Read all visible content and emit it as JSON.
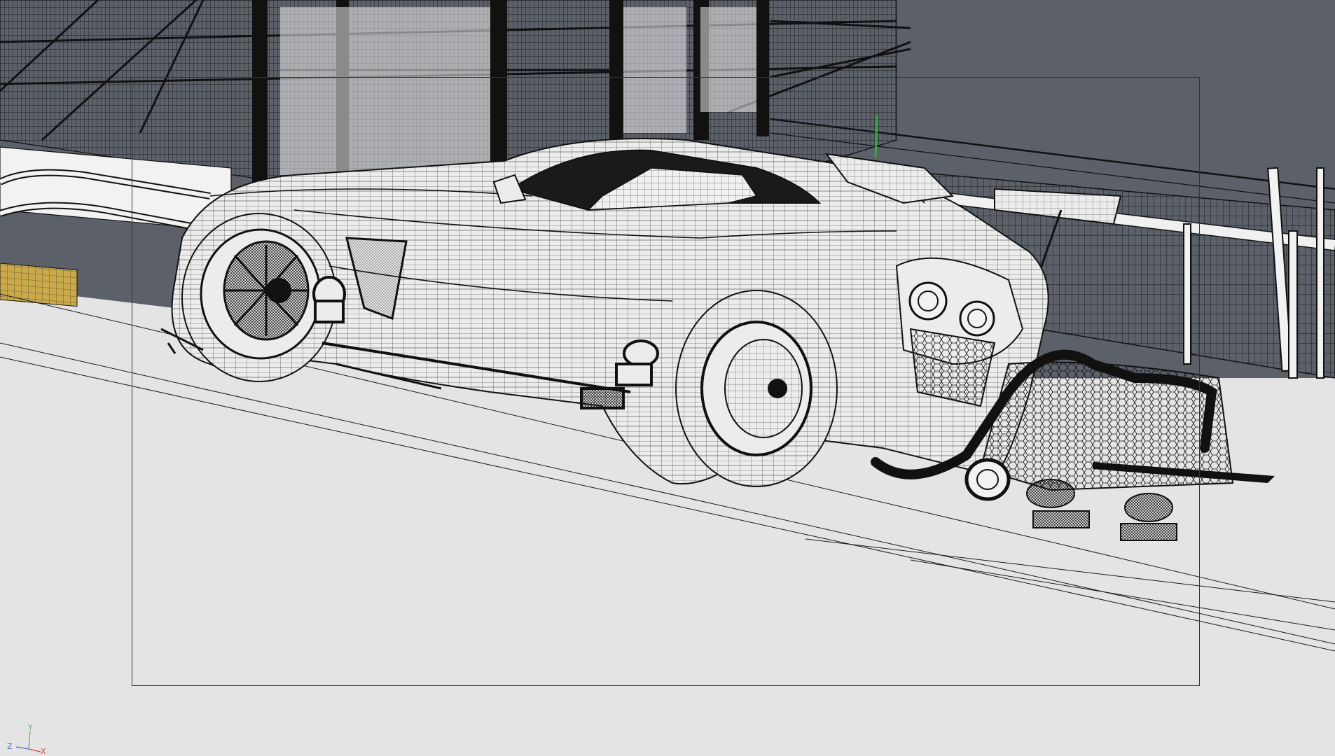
{
  "viewport": {
    "background_color": "#e4e4e4",
    "sky_color": "#5c6169",
    "wire_color": "#151515"
  },
  "axis_gizmo": {
    "z_label": "Z",
    "y_label": "Y",
    "x_label": "X",
    "colors": {
      "x": "#d04a3a",
      "y": "#5cb85c",
      "z": "#4a6fd0"
    }
  }
}
